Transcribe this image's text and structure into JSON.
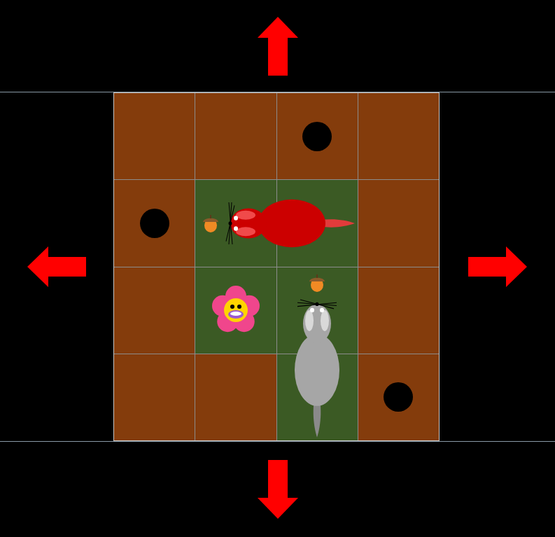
{
  "board": {
    "rows": 4,
    "cols": 4,
    "cells": [
      [
        {
          "terrain": "dirt",
          "hole": false
        },
        {
          "terrain": "dirt",
          "hole": false
        },
        {
          "terrain": "dirt",
          "hole": true
        },
        {
          "terrain": "dirt",
          "hole": false
        }
      ],
      [
        {
          "terrain": "dirt",
          "hole": true
        },
        {
          "terrain": "grass",
          "hole": false
        },
        {
          "terrain": "grass",
          "hole": false
        },
        {
          "terrain": "dirt",
          "hole": false
        }
      ],
      [
        {
          "terrain": "dirt",
          "hole": false
        },
        {
          "terrain": "grass",
          "hole": false
        },
        {
          "terrain": "grass",
          "hole": false
        },
        {
          "terrain": "dirt",
          "hole": false
        }
      ],
      [
        {
          "terrain": "dirt",
          "hole": false
        },
        {
          "terrain": "dirt",
          "hole": false
        },
        {
          "terrain": "grass",
          "hole": false
        },
        {
          "terrain": "dirt",
          "hole": true
        }
      ]
    ]
  },
  "acorns": [
    {
      "row": 1,
      "col": 1,
      "spot": "left"
    },
    {
      "row": 2,
      "col": 2,
      "spot": "top"
    }
  ],
  "flowers": [
    {
      "row": 2,
      "col": 1
    }
  ],
  "squirrels": [
    {
      "name": "red-squirrel",
      "color": "#cc0000",
      "head": [
        1,
        1
      ],
      "tail": [
        1,
        2
      ],
      "facing": "left"
    },
    {
      "name": "grey-squirrel",
      "color": "#a6a6a6",
      "head": [
        2,
        2
      ],
      "tail": [
        3,
        2
      ],
      "facing": "up"
    }
  ],
  "arrows": [
    "up",
    "left",
    "right",
    "down"
  ]
}
